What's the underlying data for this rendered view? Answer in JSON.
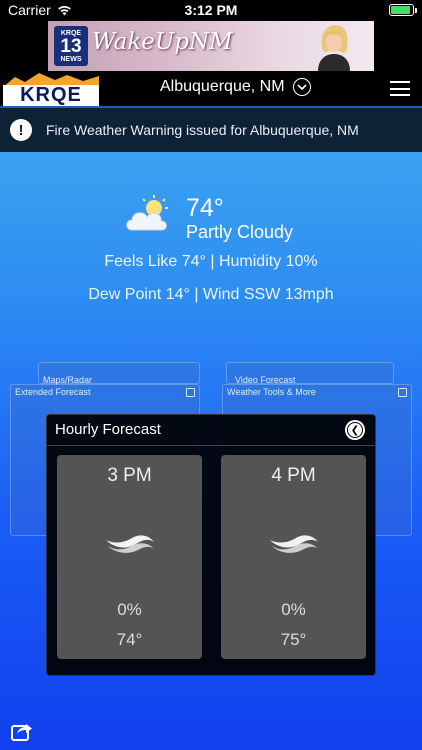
{
  "status_bar": {
    "carrier": "Carrier",
    "time": "3:12 PM",
    "battery_level": 0.9
  },
  "ad": {
    "logo_top": "KRQE",
    "logo_number": "13",
    "logo_label": "NEWS",
    "tagline": "WakeUpNM"
  },
  "header": {
    "logo_text": "KRQE",
    "location": "Albuquerque, NM"
  },
  "alert": {
    "text": "Fire Weather Warning issued for Albuquerque, NM"
  },
  "current": {
    "temp": "74°",
    "condition": "Partly Cloudy",
    "feels_humidity": "Feels Like 74° | Humidity 10%",
    "dew_wind": "Dew Point 14° | Wind SSW 13mph"
  },
  "background_cards": {
    "maps_radar": "Maps/Radar",
    "video_forecast": "Video Forecast",
    "extended_forecast": "Extended Forecast",
    "weather_tools": "Weather Tools & More"
  },
  "hourly": {
    "title": "Hourly Forecast",
    "hours": [
      {
        "time": "3 PM",
        "precip": "0%",
        "temp": "74°"
      },
      {
        "time": "4 PM",
        "precip": "0%",
        "temp": "75°"
      }
    ]
  },
  "colors": {
    "alert_bg": "#0e2236",
    "modal_bg": "#000000",
    "hour_card_bg": "#545454",
    "battery_green": "#4cd964"
  },
  "icons": [
    "wifi-icon",
    "battery-icon",
    "chevron-down-icon",
    "menu-icon",
    "alert-icon",
    "partly-cloudy-icon",
    "close-icon",
    "wind-icon",
    "share-icon"
  ]
}
